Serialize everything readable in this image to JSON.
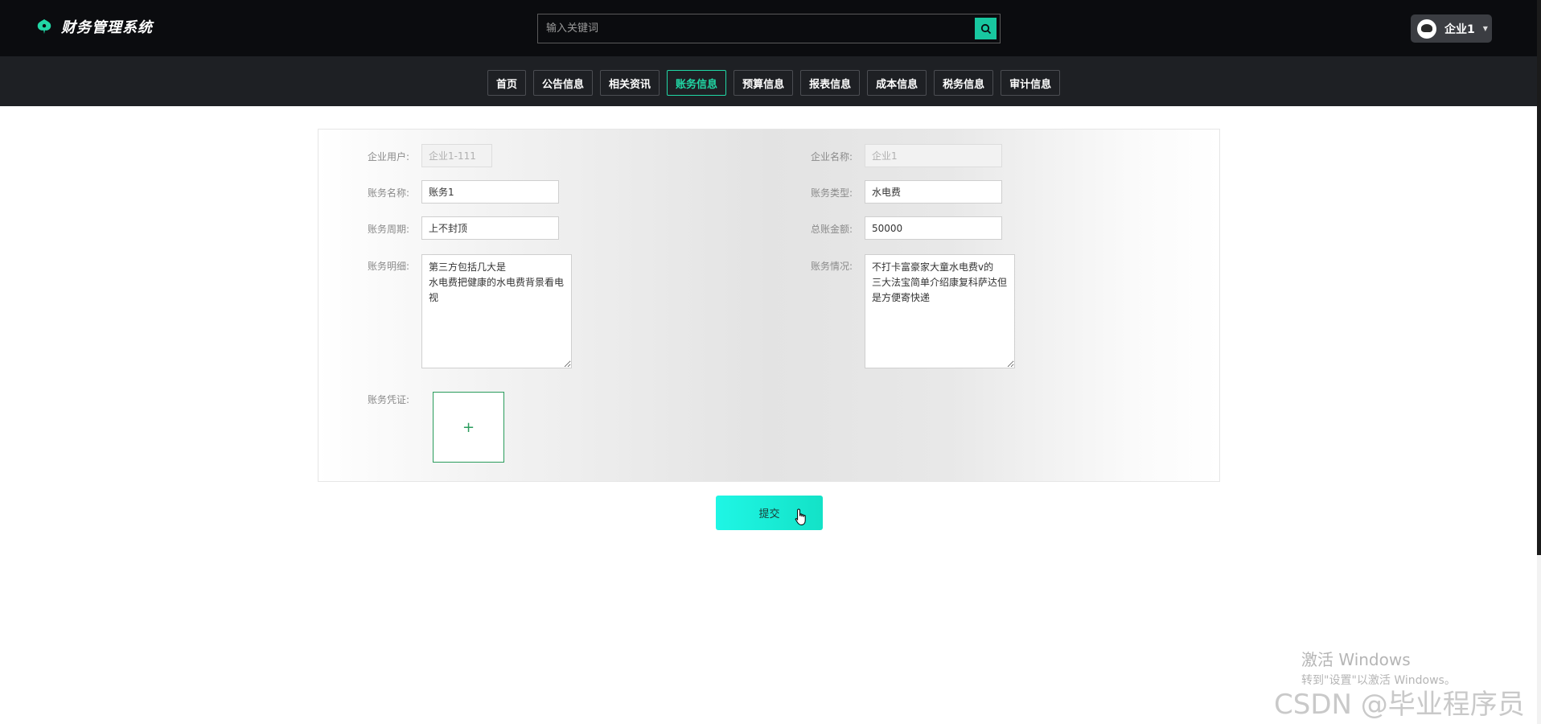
{
  "app": {
    "title": "财务管理系统"
  },
  "search": {
    "placeholder": "输入关键词",
    "value": ""
  },
  "user": {
    "name": "企业1"
  },
  "nav": {
    "items": [
      {
        "label": "首页"
      },
      {
        "label": "公告信息"
      },
      {
        "label": "相关资讯"
      },
      {
        "label": "账务信息",
        "active": true
      },
      {
        "label": "预算信息"
      },
      {
        "label": "报表信息"
      },
      {
        "label": "成本信息"
      },
      {
        "label": "税务信息"
      },
      {
        "label": "审计信息"
      }
    ]
  },
  "form": {
    "enterprise_user": {
      "label": "企业用户:",
      "value": "企业1-111"
    },
    "enterprise_name": {
      "label": "企业名称:",
      "value": "企业1"
    },
    "account_name": {
      "label": "账务名称:",
      "value": "账务1"
    },
    "account_type": {
      "label": "账务类型:",
      "value": "水电费"
    },
    "account_period": {
      "label": "账务周期:",
      "value": "上不封顶"
    },
    "total_amount": {
      "label": "总账金额:",
      "value": "50000"
    },
    "account_detail": {
      "label": "账务明细:",
      "value": "第三方包括几大是\n水电费把健康的水电费背景看电视"
    },
    "account_status": {
      "label": "账务情况:",
      "value": "不打卡富豪家大童水电费v的\n三大法宝简单介绍康复科萨达但是方便寄快递"
    },
    "voucher": {
      "label": "账务凭证:",
      "upload_symbol": "+"
    },
    "submit_label": "提交"
  },
  "watermarks": {
    "windows_title": "激活 Windows",
    "windows_sub": "转到\"设置\"以激活 Windows。",
    "csdn": "CSDN @毕业程序员"
  },
  "colors": {
    "accent": "#21d7a5",
    "header_bg": "#0b0c0f",
    "nav_bg": "#1e2024",
    "submit": "#13e2c7"
  }
}
